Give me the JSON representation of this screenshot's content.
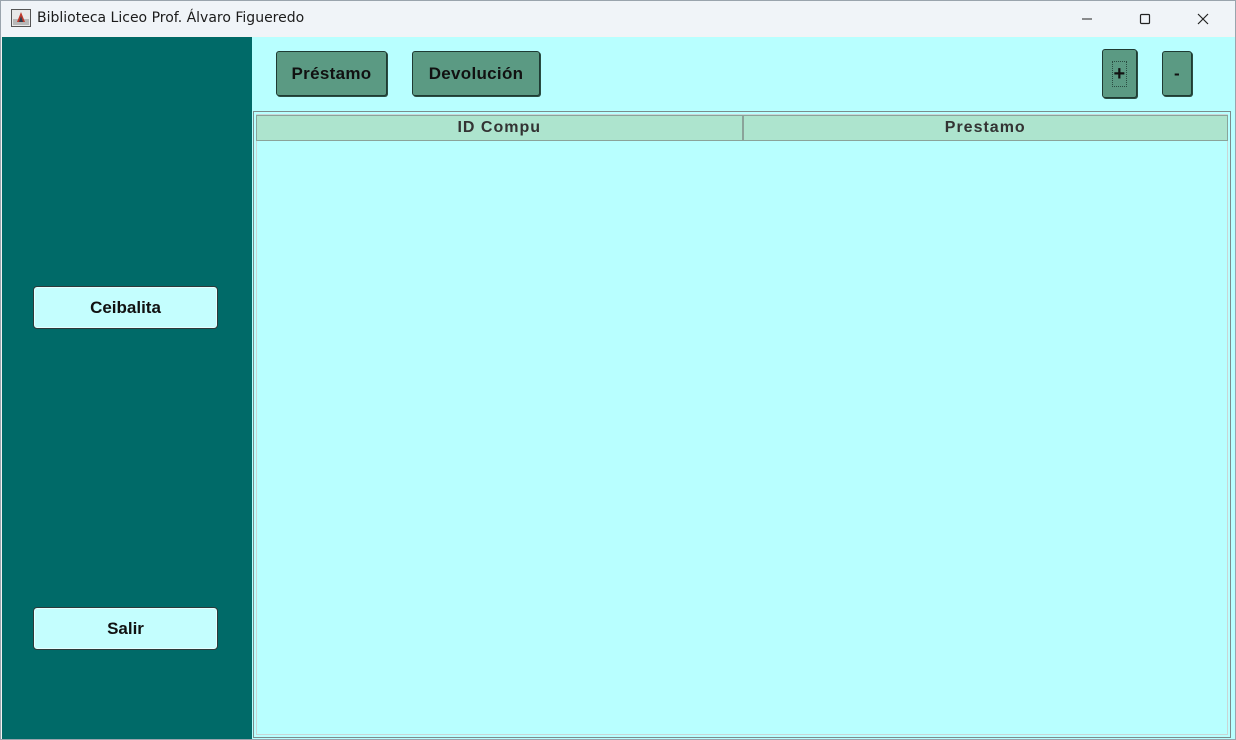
{
  "window": {
    "title": "Biblioteca Liceo Prof. Álvaro Figueredo",
    "controls": {
      "minimize_icon": "minimize-icon",
      "maximize_icon": "maximize-icon",
      "close_icon": "close-icon"
    }
  },
  "sidebar": {
    "background": "#006a68",
    "buttons": {
      "ceibalita": "Ceibalita",
      "salir": "Salir"
    }
  },
  "toolbar": {
    "prestamo_label": "Préstamo",
    "devolucion_label": "Devolución",
    "add_label": "+",
    "remove_label": "-"
  },
  "table": {
    "columns": [
      "ID Compu",
      "Prestamo"
    ],
    "rows": []
  },
  "colors": {
    "content_bg": "#b8ffff",
    "button_bg": "#5b9a83",
    "header_bg": "#ade4ce",
    "sidebar_button_bg": "#c4fefe"
  }
}
